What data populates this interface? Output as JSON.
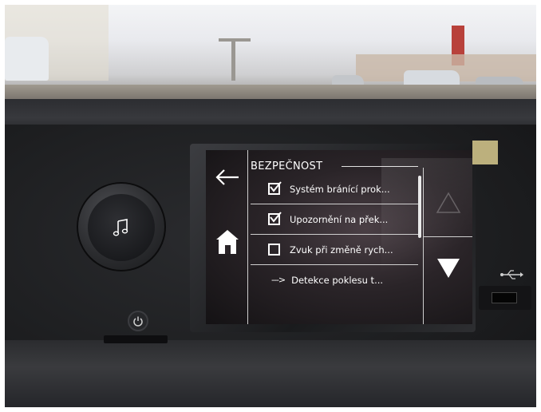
{
  "screen": {
    "title": "BEZPEČNOST",
    "back_icon": "arrow-left-icon",
    "home_icon": "home-icon",
    "items": [
      {
        "label": "Systém bránící prok...",
        "control": "checkbox",
        "checked": true
      },
      {
        "label": "Upozornění na přek...",
        "control": "checkbox",
        "checked": true
      },
      {
        "label": "Zvuk při změně rych...",
        "control": "checkbox",
        "checked": false
      },
      {
        "label": "Detekce poklesu t...",
        "control": "submenu-arrow",
        "indicator": "--->"
      }
    ],
    "scroll_up_icon": "triangle-up-icon",
    "scroll_down_icon": "triangle-down-icon"
  },
  "hardware": {
    "knob_icon": "music-note-icon",
    "power_icon": "power-icon",
    "usb_icon": "usb-icon"
  },
  "colors": {
    "screen_text": "#ffffff",
    "dash": "#1e1e20"
  }
}
